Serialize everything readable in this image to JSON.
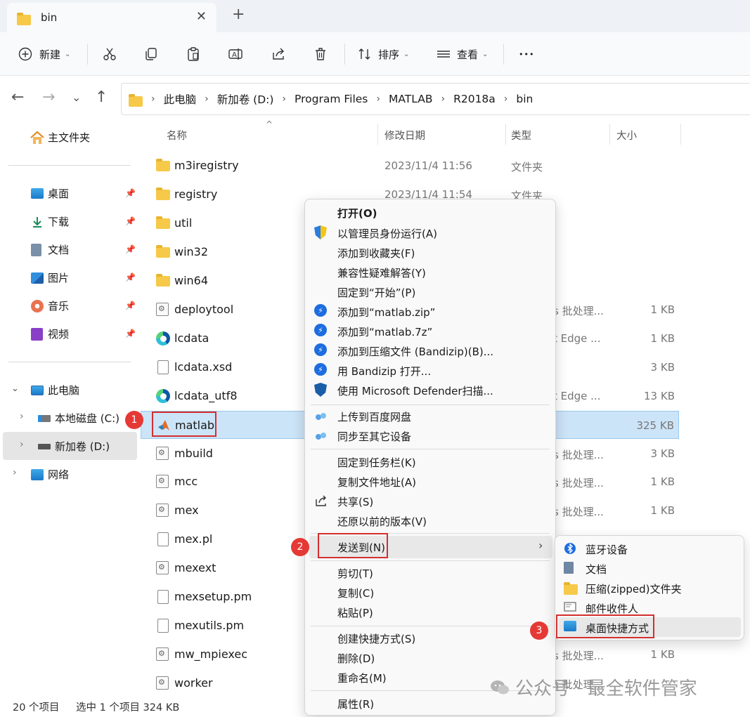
{
  "window": {
    "tab_title": "bin",
    "close_glyph": "✕",
    "new_tab_glyph": "+"
  },
  "toolbar": {
    "new_label": "新建",
    "sort_label": "排序",
    "view_label": "查看",
    "more_glyph": "•••"
  },
  "breadcrumb": [
    "此电脑",
    "新加卷 (D:)",
    "Program Files",
    "MATLAB",
    "R2018a",
    "bin"
  ],
  "sidebar": {
    "home": "主文件夹",
    "quick": [
      {
        "label": "桌面",
        "icon": "desktop-icon"
      },
      {
        "label": "下载",
        "icon": "download-icon"
      },
      {
        "label": "文档",
        "icon": "documents-icon"
      },
      {
        "label": "图片",
        "icon": "pictures-icon"
      },
      {
        "label": "音乐",
        "icon": "music-icon"
      },
      {
        "label": "视频",
        "icon": "videos-icon"
      }
    ],
    "this_pc": "此电脑",
    "drive_c": "本地磁盘 (C:)",
    "drive_d": "新加卷 (D:)",
    "network": "网络"
  },
  "columns": {
    "name": "名称",
    "date": "修改日期",
    "type": "类型",
    "size": "大小"
  },
  "files": [
    {
      "name": "m3iregistry",
      "date": "2023/11/4 11:56",
      "type": "文件夹",
      "size": "",
      "icon": "folder"
    },
    {
      "name": "registry",
      "date": "2023/11/4 11:54",
      "type": "文件夹",
      "size": "",
      "icon": "folder"
    },
    {
      "name": "util",
      "date": "",
      "type": "",
      "size": "",
      "icon": "folder"
    },
    {
      "name": "win32",
      "date": "",
      "type": "",
      "size": "",
      "icon": "folder"
    },
    {
      "name": "win64",
      "date": "",
      "type": "",
      "size": "",
      "icon": "folder"
    },
    {
      "name": "deploytool",
      "date": "",
      "type": "s 批处理...",
      "size": "1 KB",
      "icon": "batch"
    },
    {
      "name": "lcdata",
      "date": "",
      "type": "t Edge ...",
      "size": "1 KB",
      "icon": "edge"
    },
    {
      "name": "lcdata.xsd",
      "date": "",
      "type": "",
      "size": "3 KB",
      "icon": "doc"
    },
    {
      "name": "lcdata_utf8",
      "date": "",
      "type": "t Edge ...",
      "size": "13 KB",
      "icon": "edge"
    },
    {
      "name": "matlab",
      "date": "",
      "type": "",
      "size": "325 KB",
      "icon": "matlab"
    },
    {
      "name": "mbuild",
      "date": "",
      "type": "s 批处理...",
      "size": "3 KB",
      "icon": "batch"
    },
    {
      "name": "mcc",
      "date": "",
      "type": "s 批处理...",
      "size": "1 KB",
      "icon": "batch"
    },
    {
      "name": "mex",
      "date": "",
      "type": "s 批处理...",
      "size": "1 KB",
      "icon": "batch"
    },
    {
      "name": "mex.pl",
      "date": "",
      "type": "",
      "size": "",
      "icon": "doc"
    },
    {
      "name": "mexext",
      "date": "",
      "type": "",
      "size": "",
      "icon": "batch"
    },
    {
      "name": "mexsetup.pm",
      "date": "",
      "type": "",
      "size": "",
      "icon": "doc"
    },
    {
      "name": "mexutils.pm",
      "date": "",
      "type": "",
      "size": "",
      "icon": "doc"
    },
    {
      "name": "mw_mpiexec",
      "date": "",
      "type": "s 批处理...",
      "size": "1 KB",
      "icon": "batch"
    },
    {
      "name": "worker",
      "date": "",
      "type": "s 批处理...",
      "size": "",
      "icon": "batch"
    }
  ],
  "context_menu": {
    "open": "打开(O)",
    "run_as_admin": "以管理员身份运行(A)",
    "add_favorites": "添加到收藏夹(F)",
    "compat": "兼容性疑难解答(Y)",
    "pin_start": "固定到“开始”(P)",
    "add_zip": "添加到“matlab.zip”",
    "add_7z": "添加到“matlab.7z”",
    "add_archive": "添加到压缩文件 (Bandizip)(B)...",
    "open_bandizip": "用 Bandizip 打开...",
    "defender": "使用 Microsoft Defender扫描...",
    "upload_baidu": "上传到百度网盘",
    "sync_devices": "同步至其它设备",
    "pin_taskbar": "固定到任务栏(K)",
    "copy_path": "复制文件地址(A)",
    "share": "共享(S)",
    "restore": "还原以前的版本(V)",
    "send_to": "发送到(N)",
    "cut": "剪切(T)",
    "copy": "复制(C)",
    "paste": "粘贴(P)",
    "create_shortcut": "创建快捷方式(S)",
    "delete": "删除(D)",
    "rename": "重命名(M)",
    "properties": "属性(R)"
  },
  "send_to_menu": {
    "bluetooth": "蓝牙设备",
    "documents": "文档",
    "zip_folder": "压缩(zipped)文件夹",
    "mail": "邮件收件人",
    "desktop_shortcut": "桌面快捷方式"
  },
  "annotations": {
    "step1": "1",
    "step2": "2",
    "step3": "3"
  },
  "status": {
    "count": "20 个项目",
    "selected": "选中 1 个项目  324 KB"
  },
  "watermark": "公众号 · 最全软件管家",
  "colors": {
    "selection": "#cce4f7",
    "annotation_red": "#d32f2f",
    "accent": "#0067c0"
  }
}
